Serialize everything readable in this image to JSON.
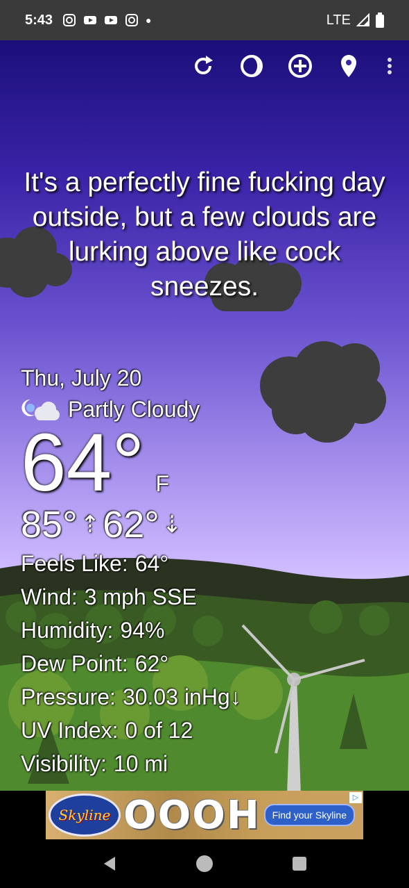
{
  "status_bar": {
    "time": "5:43",
    "network": "LTE"
  },
  "toolbar": {
    "icons": [
      "refresh-icon",
      "theme-icon",
      "add-location-icon",
      "location-pin-icon",
      "more-vert-icon"
    ]
  },
  "headline": "It's a perfectly fine fucking day outside, but a few clouds are lurking above like cock sneezes.",
  "weather": {
    "date": "Thu, July 20",
    "condition": "Partly Cloudy",
    "temperature": "64°",
    "unit": "F",
    "high": "85°",
    "low": "62°",
    "details": [
      {
        "label": "Feels Like:",
        "value": "64°"
      },
      {
        "label": "Wind:",
        "value": "3 mph SSE"
      },
      {
        "label": "Humidity:",
        "value": "94%"
      },
      {
        "label": "Dew Point:",
        "value": "62°"
      },
      {
        "label": "Pressure:",
        "value": "30.03 inHg↓"
      },
      {
        "label": "UV Index:",
        "value": "0 of 12"
      },
      {
        "label": "Visibility:",
        "value": "10 mi"
      }
    ]
  },
  "ad": {
    "brand": "Skyline",
    "headline": "OOOH",
    "cta": "Find your Skyline"
  },
  "colors": {
    "sky_top": "#1a0f7a",
    "sky_bottom": "#d9ccff",
    "cloud": "#3d3d3d",
    "hill_dark": "#2a3a1e",
    "hill_light": "#5a8a2e"
  }
}
